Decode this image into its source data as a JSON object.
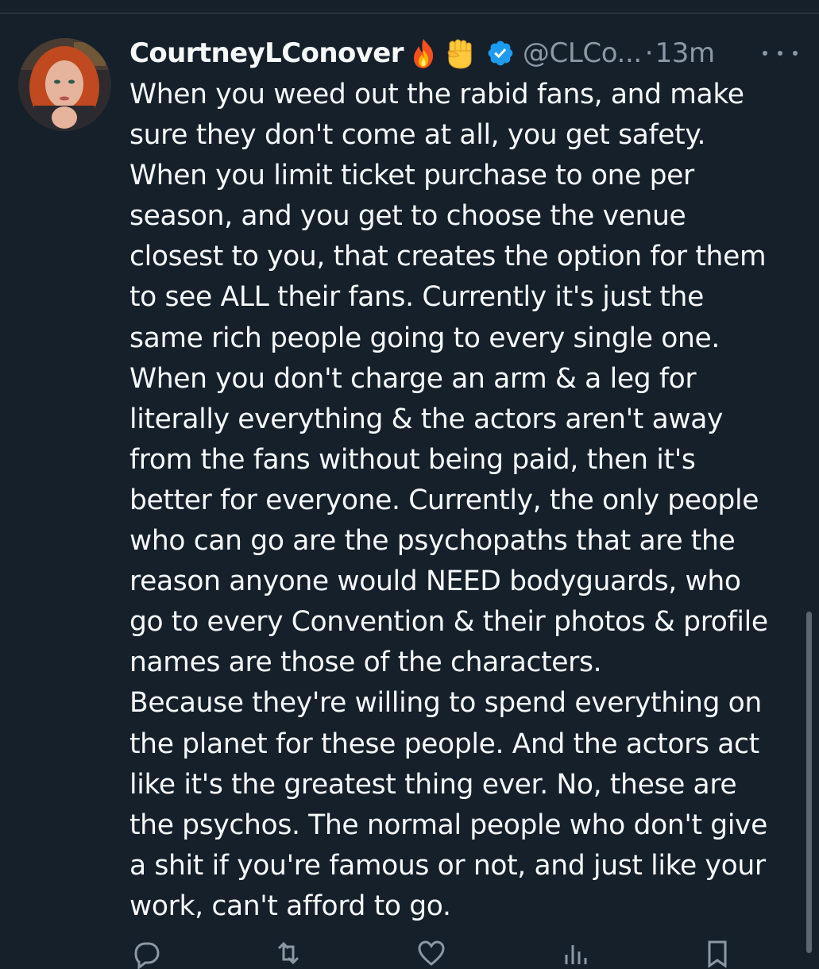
{
  "tweet": {
    "display_name": "CourtneyLConover",
    "name_emojis": [
      "fire-emoji",
      "raised-fist-emoji"
    ],
    "verified": true,
    "handle": "@CLCo...",
    "separator": "·",
    "time": "13m",
    "text_lines": [
      "When you weed out the rabid fans, and make",
      "sure they don't come at all, you get safety.",
      "When you limit ticket purchase to one per",
      "season, and you get to choose the venue",
      "closest to you, that creates the option for them",
      "to see ALL their fans.  Currently it's just the",
      "same rich people going to every single one.",
      "When you don't charge an arm & a leg for",
      "literally everything & the actors aren't away",
      "from the fans without being paid, then it's",
      "better for everyone.  Currently, the only people",
      "who can go are the psychopaths that are the",
      "reason anyone would NEED bodyguards, who",
      "go to every Convention & their photos & profile",
      "names are those of the characters.",
      "Because they're willing to spend everything on",
      "the planet for these people. And the actors act",
      "like it's the greatest thing ever.  No, these are",
      "the psychos.  The normal people who don't give",
      "a shit if you're famous or not, and just like your",
      "work, can't afford to go."
    ]
  },
  "icons": {
    "verified": "verified-badge-icon",
    "more": "more-options-icon",
    "actions": [
      "reply-icon",
      "retweet-icon",
      "like-icon",
      "views-icon",
      "bookmark-icon"
    ]
  },
  "colors": {
    "background": "#15202b",
    "text": "#f7f9f9",
    "secondary_text": "#8b98a5",
    "verified_blue": "#1d9bf0",
    "divider": "#38444d"
  }
}
